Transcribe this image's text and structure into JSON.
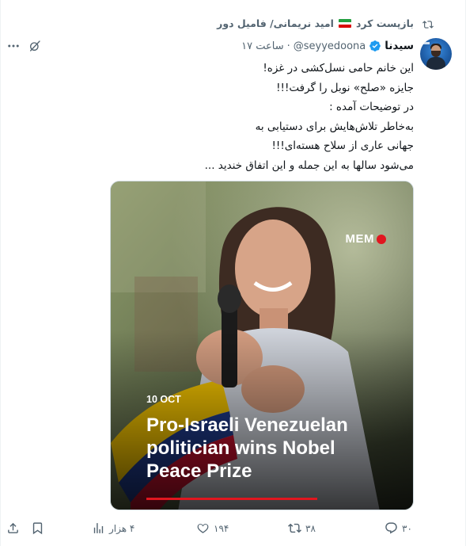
{
  "repost": {
    "label": "بازپست کرد",
    "reposter_name": "امید نریمانی/ فامیل دور",
    "flag": "iran-flag"
  },
  "tweet": {
    "display_name": "سیدنا",
    "verified": true,
    "handle": "@seyyedoona",
    "separator": "·",
    "time": "ساعت ۱۷",
    "text_lines": [
      "این خانم حامی نسل‌کشی در غزه!",
      "جایزه «صلح» نوبل را گرفت!!!",
      "در توضیحات آمده :",
      "به‌خاطر تلاش‌هایش برای دستیابی به",
      "جهانی عاری از سلاح هسته‌ای!!!",
      "می‌شود سالها به این جمله و این اتفاق خندید ..."
    ]
  },
  "media": {
    "brand": "MEM",
    "date": "10 OCT",
    "headline_lines": [
      "Pro-Israeli Venezuelan",
      "politician wins Nobel",
      "Peace Prize"
    ],
    "accent_color": "#e1161f"
  },
  "actions": {
    "replies": "۳۰",
    "reposts": "۳۸",
    "likes": "۱۹۴",
    "views": "۴ هزار",
    "icons": [
      "reply-icon",
      "repost-icon",
      "like-icon",
      "views-icon",
      "bookmark-icon",
      "share-icon"
    ]
  },
  "colors": {
    "text": "#0f1419",
    "secondary": "#536471",
    "verified": "#1d9bf0"
  }
}
